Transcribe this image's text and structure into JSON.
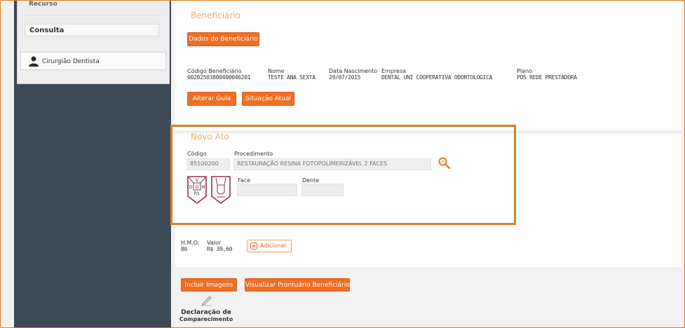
{
  "sidebar": {
    "recurso_label": "Recurso",
    "consulta_label": "Consulta",
    "user_label": "Cirurgião Dentista"
  },
  "beneficiario": {
    "title": "Beneficiário",
    "dados_button": "Dados do Beneficiário",
    "fields": {
      "codigo_label": "Código Beneficiário",
      "codigo_value": "00202503800400046201",
      "nome_label": "Nome",
      "nome_value": "TESTE ANA SEXTA",
      "nascimento_label": "Data Nascimento",
      "nascimento_value": "29/07/2015",
      "empresa_label": "Empresa",
      "empresa_value": "DENTAL UNI COOPERATIVA ODONTOLOGICA",
      "plano_label": "Plano",
      "plano_value": "POS REDE PRESTADORA"
    },
    "alterar_guia_button": "Alterar Guia",
    "situacao_atual_button": "Situação Atual"
  },
  "novo_ato": {
    "title": "Novo Ato",
    "codigo_label": "Código",
    "codigo_value": "85100200",
    "procedimento_label": "Procedimento",
    "procedimento_value": "RESTAURAÇÃO RESINA FOTOPOLIMERIZÁVEL 2 FACES",
    "face_label": "Face",
    "dente_label": "Dente",
    "tooth_letters": {
      "top": "V",
      "left": "D",
      "center": "O",
      "right": "M",
      "bottom": "P/L"
    }
  },
  "valores": {
    "hmo_label": "H.M.O.",
    "hmo_value": "80",
    "valor_label": "Valor",
    "valor_value": "R$ 39,60",
    "adicionar_button": "Adicionar"
  },
  "actions": {
    "incluir_imagens": "Incluir Imagens",
    "visualizar_prontuario": "Visualizar Prontuário Beneficiário",
    "declaracao_line1": "Declaração de",
    "declaracao_line2": "Comparecimento"
  },
  "colors": {
    "accent": "#ee6e24",
    "highlight_border": "#d4812c",
    "sidebar_dark": "#3e4a56",
    "tooth_border": "#9b2a55"
  }
}
